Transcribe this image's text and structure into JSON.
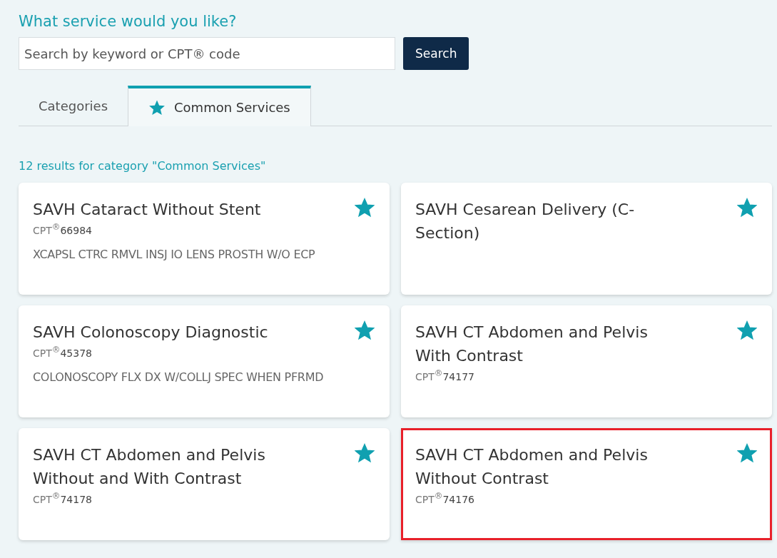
{
  "heading": "What service would you like?",
  "search": {
    "placeholder": "Search by keyword or CPT® code",
    "button": "Search"
  },
  "tabs": [
    {
      "label": "Categories",
      "selected": false,
      "starred": false
    },
    {
      "label": "Common Services",
      "selected": true,
      "starred": true
    }
  ],
  "results_summary": "12 results for category \"Common Services\"",
  "services": [
    {
      "title": "SAVH Cataract Without Stent",
      "code_label": "CPT$^{®}$",
      "code": "66984",
      "description": "XCAPSL CTRC RMVL INSJ IO LENS PROSTH W/O ECP",
      "favorite": true,
      "highlighted": false
    },
    {
      "title": "SAVH Cesarean Delivery (C-Section)",
      "favorite": true,
      "highlighted": false
    },
    {
      "title": "SAVH Colonoscopy Diagnostic",
      "code_label": "CPT$^{®}$",
      "code": "45378",
      "description": "COLONOSCOPY FLX DX W/COLLJ SPEC WHEN PFRMD",
      "favorite": true,
      "highlighted": false
    },
    {
      "title": "SAVH CT Abdomen and Pelvis With Contrast",
      "code_label": "CPT$^{®}$",
      "code": "74177",
      "favorite": true,
      "highlighted": false
    },
    {
      "title": "SAVH CT Abdomen and Pelvis Without and With Contrast",
      "code_label": "CPT$^{®}$",
      "code": "74178",
      "favorite": true,
      "highlighted": false
    },
    {
      "title": "SAVH CT Abdomen and Pelvis Without Contrast",
      "code_label": "CPT$^{®}$",
      "code": "74176",
      "favorite": true,
      "highlighted": true
    }
  ]
}
